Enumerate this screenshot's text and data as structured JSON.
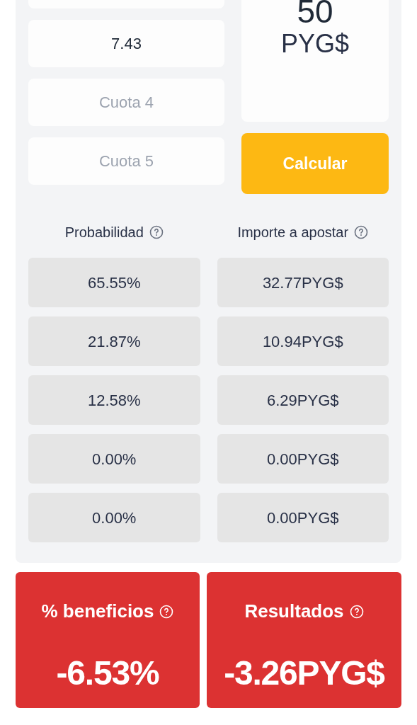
{
  "odds_fields": [
    {
      "value": "7.43"
    },
    {
      "placeholder": "Cuota 4"
    },
    {
      "placeholder": "Cuota 5"
    }
  ],
  "stake": {
    "amount": "50",
    "currency": "PYG$"
  },
  "calculate_button": "Calcular",
  "table": {
    "columns": [
      "Probabilidad",
      "Importe a apostar"
    ],
    "rows": [
      [
        "65.55%",
        "32.77PYG$"
      ],
      [
        "21.87%",
        "10.94PYG$"
      ],
      [
        "12.58%",
        "6.29PYG$"
      ],
      [
        "0.00%",
        "0.00PYG$"
      ],
      [
        "0.00%",
        "0.00PYG$"
      ]
    ]
  },
  "results": [
    {
      "label": "% beneficios",
      "value": "-6.53%"
    },
    {
      "label": "Resultados",
      "value": "-3.26PYG$"
    }
  ]
}
